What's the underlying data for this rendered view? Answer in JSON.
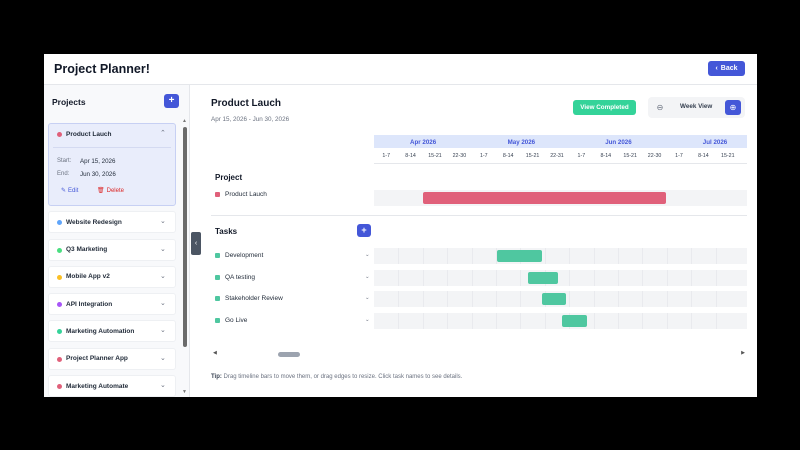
{
  "app": {
    "title": "Project Planner!",
    "back_label": "Back"
  },
  "sidebar": {
    "heading": "Projects",
    "add_label": "+",
    "active": {
      "name": "Product Lauch",
      "color": "#e0607a",
      "start_label": "Start:",
      "start_value": "Apr 15, 2026",
      "end_label": "End:",
      "end_value": "Jun 30, 2026",
      "edit_label": "Edit",
      "delete_label": "Delete"
    },
    "projects": [
      {
        "name": "Website Redesign",
        "color": "#60a5fa"
      },
      {
        "name": "Q3 Marketing",
        "color": "#4ade80"
      },
      {
        "name": "Mobile App v2",
        "color": "#fbbf24"
      },
      {
        "name": "API Integration",
        "color": "#a855f7"
      },
      {
        "name": "Marketing Automation",
        "color": "#34d399"
      },
      {
        "name": "Project Planner App",
        "color": "#e0607a"
      },
      {
        "name": "Marketing Automate",
        "color": "#e0607a"
      }
    ]
  },
  "main": {
    "title": "Product Lauch",
    "dates": "Apr 15, 2026 - Jun 30, 2026",
    "view_completed_label": "View Completed",
    "view_mode": "Week View",
    "months": [
      "Apr 2026",
      "May 2026",
      "Jun 2026",
      "Jul 2026"
    ],
    "weeks": [
      "1-7",
      "8-14",
      "15-21",
      "22-30",
      "1-7",
      "8-14",
      "15-21",
      "22-31",
      "1-7",
      "8-14",
      "15-21",
      "22-30",
      "1-7",
      "8-14",
      "15-21"
    ],
    "project_section": "Project",
    "project_row": {
      "name": "Product Lauch",
      "color": "#e0607a"
    },
    "tasks_section": "Tasks",
    "add_task_label": "+",
    "tasks": [
      {
        "name": "Development",
        "color": "#4fc7a0"
      },
      {
        "name": "QA testing",
        "color": "#4fc7a0"
      },
      {
        "name": "Stakeholder Review",
        "color": "#4fc7a0"
      },
      {
        "name": "Go Live",
        "color": "#4fc7a0"
      }
    ],
    "tip_label": "Tip:",
    "tip_text": " Drag timeline bars to move them, or drag edges to resize. Click task names to see details."
  }
}
